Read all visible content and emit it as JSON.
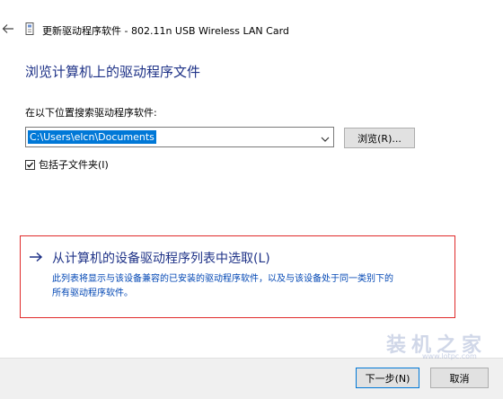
{
  "window": {
    "title": "更新驱动程序软件 - 802.11n USB Wireless LAN Card"
  },
  "page": {
    "heading": "浏览计算机上的驱动程序文件"
  },
  "search": {
    "label": "在以下位置搜索驱动程序软件:",
    "path_value": "C:\\Users\\elcn\\Documents",
    "browse_label": "浏览(R)..."
  },
  "subfolders": {
    "label": "包括子文件夹(I)",
    "checked": true
  },
  "pick_from_list": {
    "title": "从计算机的设备驱动程序列表中选取(L)",
    "description_line1": "此列表将显示与该设备兼容的已安装的驱动程序软件，以及与该设备处于同一类别下的",
    "description_line2": "所有驱动程序软件。"
  },
  "footer": {
    "next_label": "下一步(N)",
    "cancel_label": "取消"
  },
  "watermark": {
    "text": "装机之家",
    "sub": "www.lotpc.com"
  },
  "icons": {
    "back": "back-arrow-icon",
    "device": "device-driver-icon",
    "dropdown": "chevron-down-icon",
    "pick_arrow": "right-arrow-icon",
    "checkbox": "checkmark-icon"
  },
  "colors": {
    "heading": "#1e3287",
    "link": "#0046b4",
    "highlight_box": "#e02a2a",
    "selection": "#0078d7",
    "footer_bg": "#f0f0f0"
  }
}
